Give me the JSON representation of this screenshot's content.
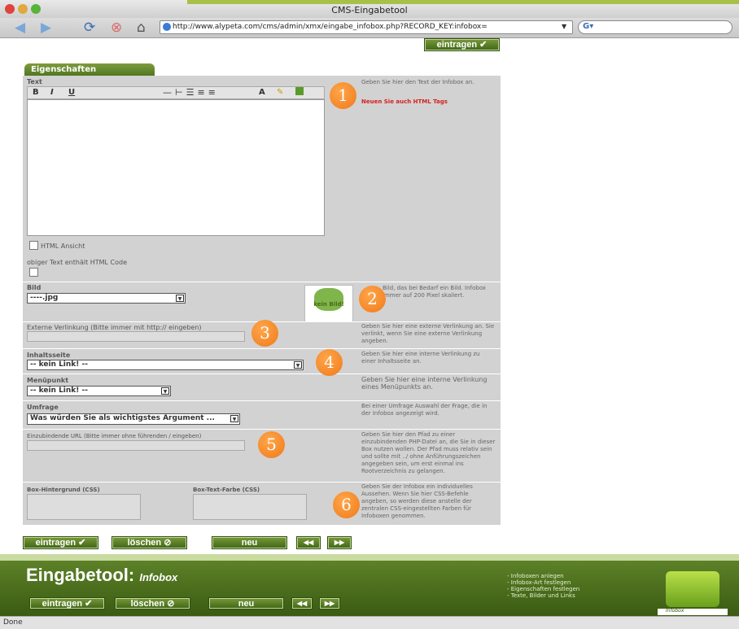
{
  "window": {
    "title": "CMS-Eingabetool"
  },
  "browser": {
    "url": "http://www.alypeta.com/cms/admin/xmx/eingabe_infobox.php?RECORD_KEY:infobox=",
    "search_placeholder": "",
    "status": "Done",
    "nav_back_icon": "back-arrow-icon",
    "nav_forward_icon": "forward-arrow-icon"
  },
  "form": {
    "tab_label": "Eigenschaften",
    "text_label": "Text",
    "toolbar": {
      "bold": "B",
      "italic": "I",
      "underline": "U"
    },
    "html_checkbox_label": "HTML Ansicht",
    "html_code_label": "obiger Text enthält HTML Code",
    "text_hint_1": "Geben Sie hier den Text der Infobox an.",
    "text_hint_2": "Neuen Sie auch HTML Tags",
    "bild_label": "Bild",
    "bild_value": "----.jpg",
    "bild_preview": "kein Bild!",
    "bild_hint": "Bild, das bei Bedarf ein Bild. Infobox immer auf 200 Pixel skaliert.",
    "external_link_label": "Externe Verlinkung (Bitte immer mit http:// eingeben)",
    "external_link_hint": "Geben Sie hier eine externe Verlinkung an. Sie verlinkt, wenn Sie eine externe Verlinkung angeben.",
    "inhaltsseite_label": "Inhaltsseite",
    "inhaltsseite_value": "-- kein Link! --",
    "inhaltsseite_hint": "Geben Sie hier eine interne Verlinkung zu einer Inhaltsseite an.",
    "menupunkt_label": "Menüpunkt",
    "menupunkt_value": "-- kein Link! --",
    "menupunkt_hint": "Geben Sie hier eine interne Verlinkung eines Menüpunkts an.",
    "umfrage_label": "Umfrage",
    "umfrage_value": "Was würden Sie als wichtigstes Argument ...",
    "umfrage_hint": "Bei einer Umfrage Auswahl der Frage, die in der Infobox angezeigt wird.",
    "include_label": "Einzubindende URL (Bitte immer ohne führenden / eingeben)",
    "include_hint": "Geben Sie hier den Pfad zu einer einzubindenden PHP-Datei an, die Sie in dieser Box nutzen wollen. Der Pfad muss relativ sein und sollte mit ../ ohne Anführungszeichen angegeben sein, um erst einmal ins Rootverzeichnis zu gelangen.",
    "bg_label": "Box-Hintergrund (CSS)",
    "textcolor_label": "Box-Text-Farbe (CSS)",
    "css_hint": "Geben Sie der Infobox ein individuelles Aussehen. Wenn Sie hier CSS-Befehle angeben, so werden diese anstelle der zentralen CSS-eingestellten Farben für Infoboxen genommen."
  },
  "buttons": {
    "eintragen": "eintragen",
    "loeschen": "löschen",
    "neu": "neu",
    "prev": "◀◀",
    "next": "▶▶"
  },
  "callouts": [
    "1",
    "2",
    "3",
    "4",
    "5",
    "6"
  ],
  "footer": {
    "title_main": "Eingabetool:",
    "title_sub": "Infobox",
    "side_items": [
      "- Infoboxen anlegen",
      "- Infobox-Art festlegen",
      "- Eigenschaften festlegen",
      "- Texte, Bilder und Links"
    ],
    "box_label": "Infobox"
  },
  "colors": {
    "accent": "#4e7420",
    "callout": "#f07a1a",
    "panel": "#d2d2d2"
  }
}
